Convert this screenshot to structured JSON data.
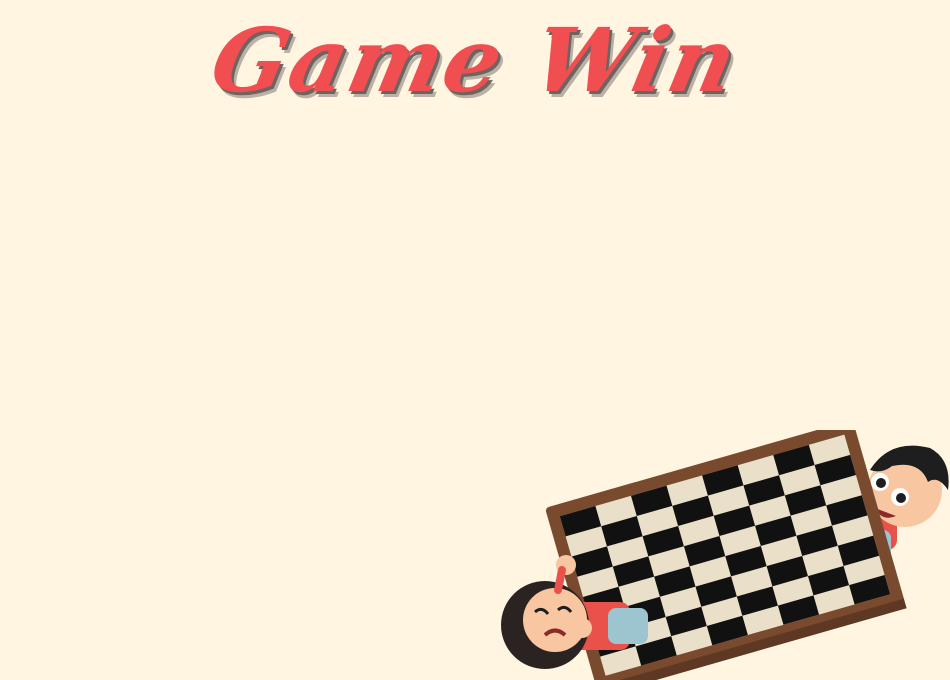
{
  "title": "Game Win",
  "colors": {
    "background": "#FFF5E0",
    "title": "#F04E50",
    "title_shadow": "#6B6460",
    "board_frame": "#7A4A2E",
    "board_light": "#EADFC8",
    "board_dark": "#111111"
  },
  "illustration": {
    "board": "checkerboard",
    "kids": [
      "crying-kid",
      "happy-kid"
    ]
  }
}
